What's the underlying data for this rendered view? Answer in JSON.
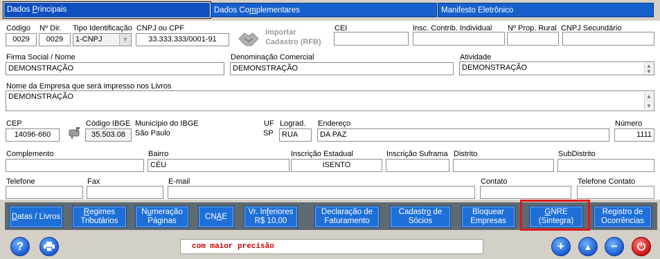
{
  "tabs": [
    {
      "label_pre": "Dados ",
      "label_ul": "P",
      "label_post": "rincipais"
    },
    {
      "label_pre": "Dados Co",
      "label_ul": "m",
      "label_post": "plementares"
    },
    {
      "label_pre": "Manifesto Eletrônico",
      "label_ul": "",
      "label_post": ""
    }
  ],
  "labels": {
    "codigo": "Código",
    "n_dir": "Nº Dir.",
    "tipo_ident": "Tipo Identificação",
    "cnpj_cpf": "CNPJ ou CPF",
    "importar": "Importar",
    "cadastro_rfb": "Cadastro (RFB)",
    "cei": "CEI",
    "insc_contrib": "Insc. Contrib. Individual",
    "prop_rural": "Nº Prop. Rural",
    "cnpj_sec": "CNPJ Secundário",
    "firma": "Firma Social / Nome",
    "denominacao": "Denominação Comercial",
    "atividade": "Atividade",
    "nome_livros": "Nome da Empresa que será impresso nos Livros",
    "cep": "CEP",
    "codigo_ibge": "Código IBGE",
    "municipio_ibge": "Município do IBGE",
    "uf": "UF",
    "lograd": "Lograd.",
    "endereco": "Endereço",
    "numero": "Número",
    "complemento": "Complemento",
    "bairro": "Bairro",
    "insc_estadual": "Inscrição Estadual",
    "insc_suframa": "Inscrição Suframa",
    "distrito": "Distrito",
    "subdistrito": "SubDistrito",
    "telefone": "Telefone",
    "fax": "Fax",
    "email": "E-mail",
    "contato": "Contato",
    "tel_contato": "Telefone Contato"
  },
  "values": {
    "codigo": "0029",
    "n_dir": "0029",
    "tipo_ident": "1-CNPJ",
    "cnpj_cpf": "33.333.333/0001-91",
    "cei": "",
    "insc_contrib": "",
    "prop_rural": "",
    "cnpj_sec": "",
    "firma": "DEMONSTRAÇÃO",
    "denominacao": "DEMONSTRAÇÃO",
    "atividade": "DEMONSTRAÇÃO",
    "nome_livros": "DEMONSTRAÇÃO",
    "cep": "14096-660",
    "codigo_ibge": "35.503.08",
    "municipio_ibge": "São Paulo",
    "uf": "SP",
    "lograd": "RUA",
    "endereco": "DA PAZ",
    "numero": "1111",
    "complemento": "",
    "bairro": "CÉU",
    "insc_estadual": "ISENTO",
    "insc_suframa": "",
    "distrito": "",
    "subdistrito": "",
    "telefone": "",
    "fax": "",
    "email": "",
    "contato": "",
    "tel_contato": ""
  },
  "buttons": [
    {
      "l1_pre": "",
      "l1_ul": "D",
      "l1_post": "atas / Livros",
      "l2": ""
    },
    {
      "l1_pre": "",
      "l1_ul": "R",
      "l1_post": "egimes",
      "l2": "Tributários"
    },
    {
      "l1_pre": "N",
      "l1_ul": "u",
      "l1_post": "meração",
      "l2": "Páginas"
    },
    {
      "l1_pre": "CN",
      "l1_ul": "A",
      "l1_post": "E",
      "l2": ""
    },
    {
      "l1_pre": "Vr. In",
      "l1_ul": "f",
      "l1_post": "eriores",
      "l2": "R$ 10,00"
    },
    {
      "l1_pre": "Declaração de",
      "l1_ul": "",
      "l1_post": "",
      "l2": "Faturamento"
    },
    {
      "l1_pre": "Cadastr",
      "l1_ul": "o",
      "l1_post": " de",
      "l2": "Sócios"
    },
    {
      "l1_pre": "Bloquear",
      "l1_ul": "",
      "l1_post": "",
      "l2": "Empresas"
    },
    {
      "l1_pre": "",
      "l1_ul": "G",
      "l1_post": "NRE",
      "l2": "(Sintegra)"
    },
    {
      "l1_pre": "Registro de",
      "l1_ul": "",
      "l1_post": "",
      "l2": "Ocorrências"
    }
  ],
  "status_message": "com maior precisão",
  "icons": {
    "help": "?",
    "add": "+",
    "up": "▲",
    "remove": "−",
    "power": "⏻"
  },
  "colors": {
    "tab_blue": "#1660cc",
    "button_blue": "#1e6fd8",
    "highlight_red": "#e01818",
    "message_red": "#cc0000"
  }
}
